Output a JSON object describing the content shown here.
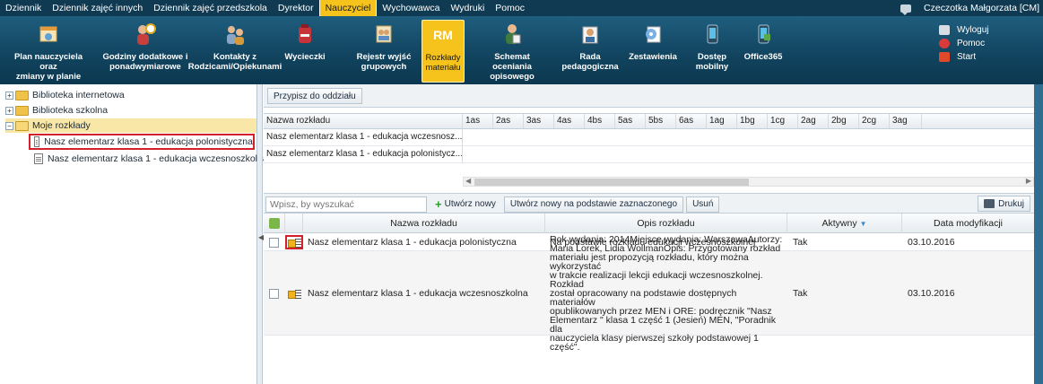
{
  "menu": {
    "items": [
      {
        "label": "Dziennik",
        "active": false
      },
      {
        "label": "Dziennik zajęć innych",
        "active": false
      },
      {
        "label": "Dziennik zajęć przedszkola",
        "active": false
      },
      {
        "label": "Dyrektor",
        "active": false
      },
      {
        "label": "Nauczyciel",
        "active": true
      },
      {
        "label": "Wychowawca",
        "active": false
      },
      {
        "label": "Wydruki",
        "active": false
      },
      {
        "label": "Pomoc",
        "active": false
      }
    ],
    "user": "Czeczotka Małgorzata [CM]"
  },
  "toolbar": {
    "buttons": [
      {
        "label": "Plan nauczyciela oraz\nzmiany w planie",
        "icon": "timetable-icon"
      },
      {
        "label": "Godziny dodatkowe i\nponadwymiarowe",
        "icon": "extra-hours-icon"
      },
      {
        "label": "Kontakty z\nRodzicami/Opiekunami",
        "icon": "contacts-icon"
      },
      {
        "label": "Wycieczki",
        "icon": "trips-icon"
      },
      {
        "label": "Rejestr wyjść\ngrupowych",
        "icon": "group-exits-icon"
      },
      {
        "label": "Rozkłady\nmateriału",
        "icon": "rm-icon",
        "icon_text": "RM",
        "active": true
      },
      {
        "label": "Schemat oceniania\nopisowego",
        "icon": "grading-scheme-icon"
      },
      {
        "label": "Rada\npedagogiczna",
        "icon": "teachers-council-icon"
      },
      {
        "label": "Zestawienia",
        "icon": "reports-icon"
      },
      {
        "label": "Dostęp\nmobilny",
        "icon": "mobile-access-icon"
      },
      {
        "label": "Office365",
        "icon": "office365-icon"
      }
    ],
    "right": [
      {
        "label": "Wyloguj",
        "icon": "lock-icon"
      },
      {
        "label": "Pomoc",
        "icon": "lifebuoy-icon"
      },
      {
        "label": "Start",
        "icon": "home-icon"
      }
    ]
  },
  "tree": {
    "nodes": [
      {
        "label": "Biblioteka internetowa",
        "type": "folder"
      },
      {
        "label": "Biblioteka szkolna",
        "type": "folder"
      },
      {
        "label": "Moje rozkłady",
        "type": "folder-open"
      },
      {
        "label": "Nasz elementarz klasa 1 - edukacja polonistyczna",
        "type": "doc"
      },
      {
        "label": "Nasz elementarz klasa 1 - edukacja wczesnoszkolna",
        "type": "doc"
      }
    ]
  },
  "assign_button": "Przypisz do oddziału",
  "class_grid": {
    "name_header": "Nazwa rozkładu",
    "columns": [
      "1as",
      "2as",
      "3as",
      "4as",
      "4bs",
      "5as",
      "5bs",
      "6as",
      "1ag",
      "1bg",
      "1cg",
      "2ag",
      "2bg",
      "2cg",
      "3ag"
    ],
    "rows": [
      "Nasz elementarz klasa 1 - edukacja wczesnosz...",
      "Nasz elementarz klasa 1 - edukacja polonistycz..."
    ]
  },
  "actions": {
    "search_placeholder": "Wpisz, by wyszukać",
    "create_new": "Utwórz nowy",
    "create_from_selected": "Utwórz nowy na podstawie zaznaczonego",
    "delete": "Usuń",
    "print": "Drukuj"
  },
  "list": {
    "headers": {
      "name": "Nazwa rozkładu",
      "description": "Opis rozkładu",
      "active": "Aktywny",
      "modified": "Data modyfikacji"
    },
    "rows": [
      {
        "name": "Nasz elementarz klasa 1 - edukacja polonistyczna",
        "description": "Na podstawie rozkładu edukacji wczesnoszkolnej",
        "active": "Tak",
        "modified": "03.10.2016"
      },
      {
        "name": "Nasz elementarz klasa 1 - edukacja wczesnoszkolna",
        "description": "Rok wydania: 2014Miejsce wydania: WarszawaAutorzy:\nMaria Lorek, Lidia WollmanOpis: Przygotowany rozkład\nmateriału jest propozycją rozkładu, który można wykorzystać\nw trakcie realizacji lekcji edukacji wczesnoszkolnej. Rozkład\nzostał opracowany na podstawie dostępnych materiałów\nopublikowanych przez MEN i ORE: podręcznik \"Nasz\nElementarz \" klasa 1 część 1 (Jesień) MEN, \"Poradnik dla\nnauczyciela klasy pierwszej szkoły podstawowej 1 część\".",
        "active": "Tak",
        "modified": "03.10.2016"
      }
    ]
  }
}
